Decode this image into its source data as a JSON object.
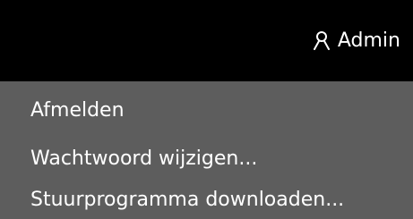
{
  "header": {
    "user_icon": "user-icon",
    "user_label": "Admin"
  },
  "menu": {
    "items": [
      {
        "label": "Afmelden"
      },
      {
        "label": "Wachtwoord wijzigen..."
      },
      {
        "label": "Stuurprogramma downloaden..."
      }
    ]
  },
  "colors": {
    "header_bg": "#000000",
    "menu_bg": "#5d5d5d",
    "text": "#ffffff"
  }
}
